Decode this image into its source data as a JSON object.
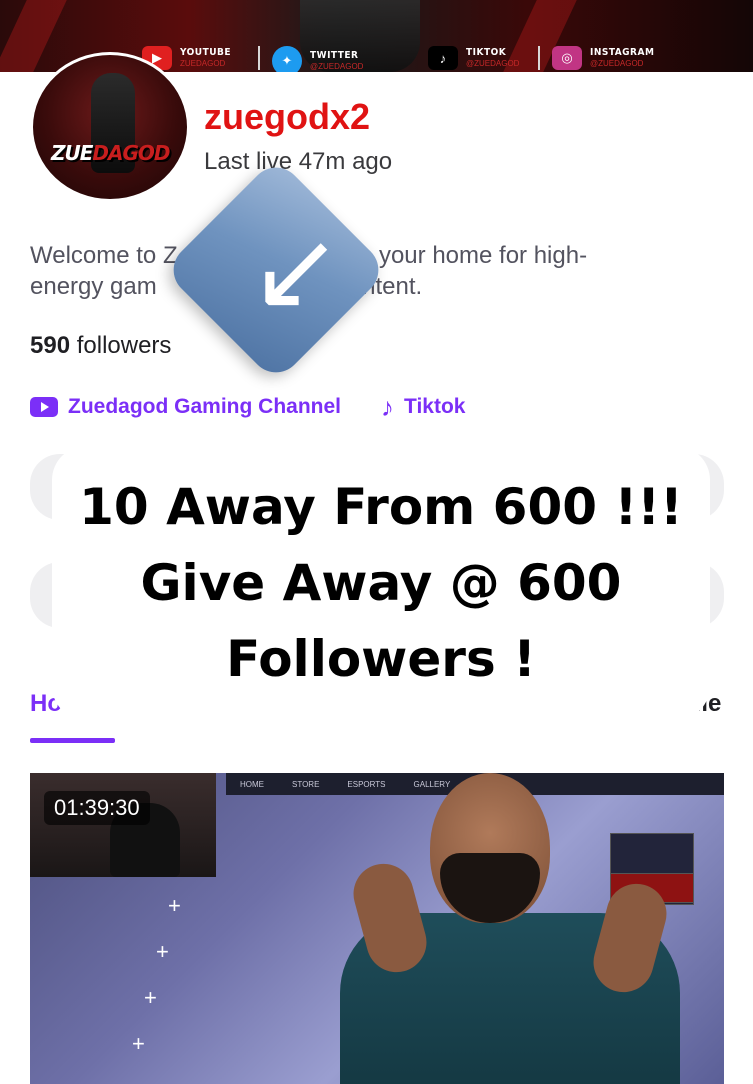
{
  "banner": {
    "socials": [
      {
        "label": "YOUTUBE",
        "handle": "ZUEDAGOD",
        "icon": "youtube-icon",
        "color": "#e02020"
      },
      {
        "label": "TWITTER",
        "handle": "@ZUEDAGOD",
        "icon": "twitter-icon",
        "color": "#1d9bf0"
      },
      {
        "label": "TIKTOK",
        "handle": "@ZUEDAGOD",
        "icon": "tiktok-icon",
        "color": "#000000"
      },
      {
        "label": "INSTAGRAM",
        "handle": "@ZUEDAGOD",
        "icon": "instagram-icon",
        "color": "#c13584"
      }
    ]
  },
  "profile": {
    "avatar_text_white": "ZUE",
    "avatar_text_red": "DAGOD",
    "channel_name": "zuegodx2",
    "last_live": "Last live 47m ago",
    "bio_line1": "Welcome to Z                       is is your home for high-",
    "bio_line2": "energy gam                           content.",
    "followers_count": "590",
    "followers_label": "followers"
  },
  "links": {
    "youtube_label": "Zuedagod Gaming Channel",
    "tiktok_label": "Tiktok"
  },
  "tabs": {
    "home": "Ho",
    "schedule": "dule"
  },
  "overlay": {
    "line1": "10 Away From 600 !!!",
    "line2": "Give Away @ 600",
    "line3": "Followers !"
  },
  "video": {
    "timestamp": "01:39:30"
  },
  "colors": {
    "accent": "#7b2ff7",
    "channel_name": "#e01313"
  }
}
